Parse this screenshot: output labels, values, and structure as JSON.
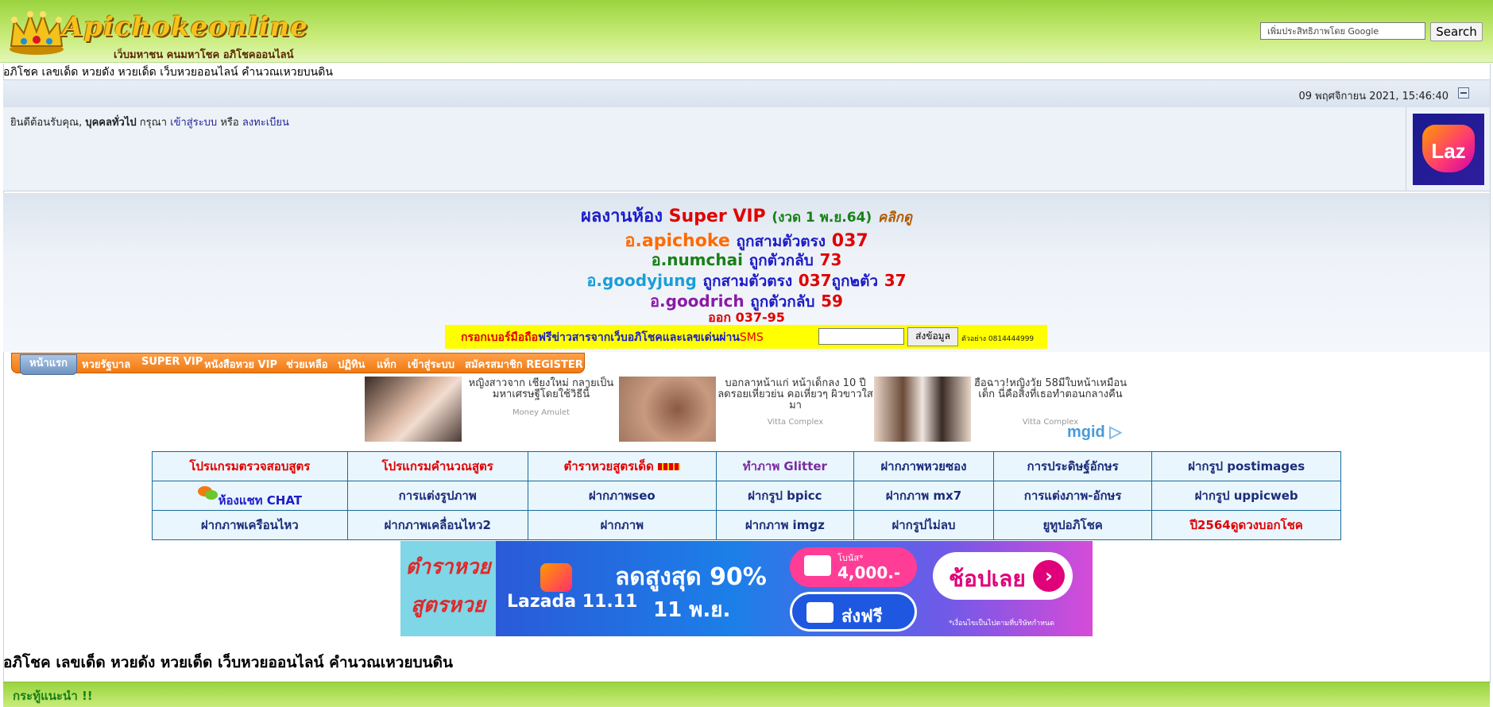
{
  "header": {
    "site_title": "Apichokeonline",
    "site_subtitle": "เว็บมหาชน คนมหาโชค อภิโชคออนไลน์",
    "search_placeholder": "เพิ่มประสิทธิภาพโดย Google",
    "search_button": "Search"
  },
  "tagline": "อภิโชค เลขเด็ด หวยดัง หวยเด็ด เว็บหวยออนไลน์ คำนวณเหวยบนดิน",
  "datebar": {
    "date": "09 พฤศจิกายน 2021, 15:46:40"
  },
  "welcome": {
    "prefix": "ยินดีต้อนรับคุณ,",
    "user": "บุคคลทั่วไป",
    "please": "กรุณา",
    "login": "เข้าสู่ระบบ",
    "or": "หรือ",
    "register": "ลงทะเบียน",
    "ad_logo_text": "Laz"
  },
  "vip": {
    "heading_a": "ผลงานห้อง",
    "heading_b": "Super VIP",
    "heading_c": "(งวด 1 พ.ย.64)",
    "click": "คลิกดู",
    "lines": [
      {
        "name": "อ.apichoke",
        "text": "ถูกสามตัวตรง",
        "num": "037",
        "extra": "",
        "num2": ""
      },
      {
        "name": "อ.numchai",
        "text": "ถูกตัวกลับ",
        "num": "73",
        "extra": "",
        "num2": ""
      },
      {
        "name": "อ.goodyjung",
        "text": "ถูกสามตัวตรง",
        "num": "037",
        "extra": "ถูก๒ตัว",
        "num2": "37"
      },
      {
        "name": "อ.goodrich",
        "text": "ถูกตัวกลับ",
        "num": "59",
        "extra": "",
        "num2": ""
      }
    ],
    "result": "ออก 037-95"
  },
  "sms": {
    "label_red": "กรอกเบอร์มือถือ",
    "label_blue": "ฟรีข่าวสารจากเว็บอภิโชคและเลขเด่นผ่าน",
    "label_sms": "SMS",
    "button": "ส่งข้อมูล",
    "example": "ตัวอย่าง 0814444999"
  },
  "nav": {
    "home": "หน้าแรก",
    "items": [
      "หวยรัฐบาล",
      "SUPER VIP",
      "หนังสือหวย VIP",
      "ช่วยเหลือ",
      "ปฏิทิน",
      "แท็ก",
      "เข้าสู่ระบบ",
      "สมัครสมาชิก REGISTER"
    ]
  },
  "ads": [
    {
      "title": "หญิงสาวจาก เชียงใหม่ กลายเป็นมหาเศรษฐีโดยใช้วิธีนี้",
      "source": "Money Amulet"
    },
    {
      "title": "บอกลาหน้าแก่ หน้าเด็กลง 10 ปี ลดรอยเหี่ยวย่น คอเหี่ยวๆ ผิวขาวใสมา",
      "source": "Vitta Complex"
    },
    {
      "title": "ฮือฉาว!หญิงวัย 58มีใบหน้าเหมือนเด็ก นี่คือสิ่งที่เธอทำตอนกลางคืน",
      "source": "Vitta Complex"
    }
  ],
  "mgid": "mgid",
  "links": [
    [
      "โปรแกรมตรวจสอบสูตร",
      "โปรแกรมคำนวณสูตร",
      "ตำราหวยสูตรเด็ด",
      "ทำภาพ Glitter",
      "ฝากภาพหวยซอง",
      "การประดิษฐ์อักษร",
      "ฝากรูป postimages"
    ],
    [
      "ห้องแชท CHAT",
      "การแต่งรูปภาพ",
      "ฝากภาพseo",
      "ฝากรูป bpicc",
      "ฝากภาพ mx7",
      "การแต่งภาพ-อักษร",
      "ฝากรูป uppicweb"
    ],
    [
      "ฝากภาพเครือนไหว",
      "ฝากภาพเคลื่อนไหว2",
      "ฝากภาพ",
      "ฝากภาพ imgz",
      "ฝากรูปไม่ลบ",
      "ยูทูปอภิโชค",
      "ปี2564ดูดวงบอกโชค"
    ]
  ],
  "banner": {
    "left_1": "ตำราหวย",
    "left_2": "สูตรหวย",
    "brand": "Lazada 11.11",
    "sale": "ลดสูงสุด 90%",
    "date": "11 พ.ย.",
    "bonus_label": "โบนัส*",
    "bonus": "4,000.-",
    "shipping": "ส่งฟรี",
    "shop": "ช้อปเลย",
    "fine": "*เงื่อนไขเป็นไปตามที่บริษัทกำหนด"
  },
  "tagline_bottom": "อภิโชค เลขเด็ด หวยดัง หวยเด็ด เว็บหวยออนไลน์ คำนวณเหวยบนดิน",
  "recommend": "กระทู้แนะนำ !!"
}
